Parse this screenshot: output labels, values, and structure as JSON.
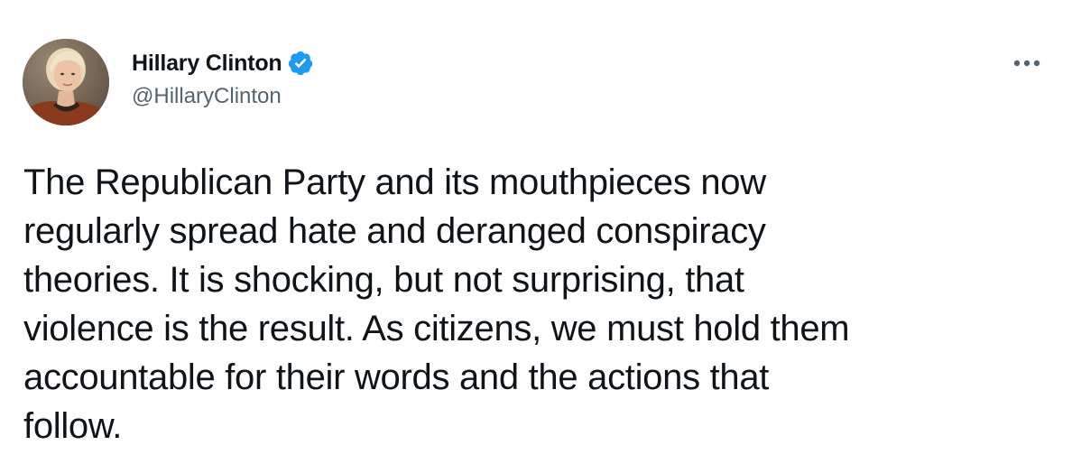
{
  "tweet": {
    "author": {
      "display_name": "Hillary Clinton",
      "handle": "@HillaryClinton",
      "verified": true,
      "avatar_icon": "profile-photo"
    },
    "menu_icon": "more-options-icon",
    "text_lines": [
      "The Republican Party and its mouthpieces now",
      "regularly spread hate and deranged conspiracy",
      "theories. It is shocking, but not surprising, that",
      "violence is the result. As citizens, we must hold them",
      "accountable for their words and the actions that",
      "follow."
    ]
  },
  "colors": {
    "verified_blue": "#1d9bf0",
    "text_primary": "#0f1419",
    "text_secondary": "#536471",
    "background": "#ffffff"
  }
}
